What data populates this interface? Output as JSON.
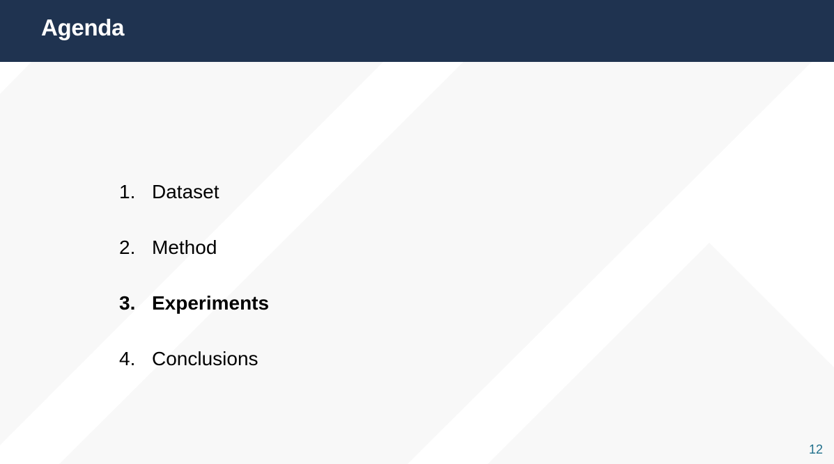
{
  "slide": {
    "title": "Agenda",
    "agenda": [
      {
        "number": "1.",
        "label": "Dataset",
        "current": false
      },
      {
        "number": "2.",
        "label": "Method",
        "current": false
      },
      {
        "number": "3.",
        "label": "Experiments",
        "current": true
      },
      {
        "number": "4.",
        "label": "Conclusions",
        "current": false
      }
    ],
    "page_number": "12"
  },
  "colors": {
    "header_background": "#1f3350",
    "title_text": "#ffffff",
    "body_text": "#000000",
    "page_number": "#1f6f8b",
    "background_stripes": "#f8f8f8"
  }
}
